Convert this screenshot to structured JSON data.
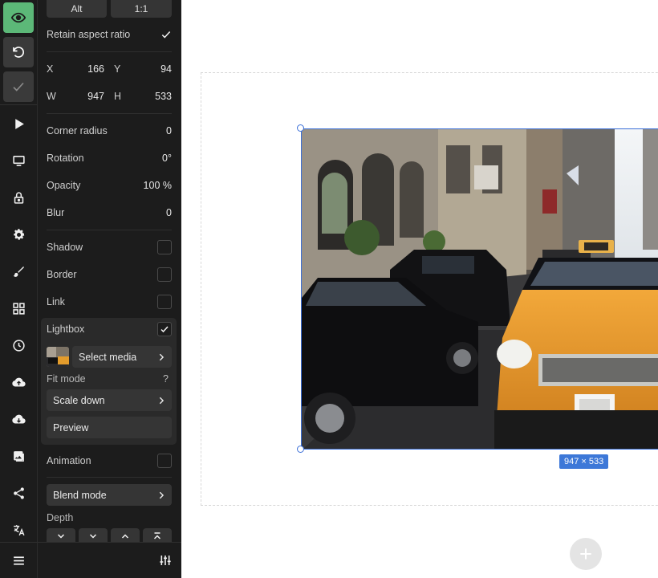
{
  "toolbar": {
    "rail_icons": [
      "eye-icon",
      "undo-icon",
      "check-icon",
      "play-icon",
      "monitor-icon",
      "lock-icon",
      "gear-icon",
      "brush-icon",
      "grid-icon",
      "clock-icon",
      "cloud-upload-icon",
      "cloud-download-icon",
      "image-icon",
      "share-icon",
      "translate-icon",
      "menu-icon"
    ]
  },
  "panel": {
    "alt_label": "Alt",
    "ratio_label": "1:1",
    "retain_aspect_label": "Retain aspect ratio",
    "retain_aspect_checked": true,
    "x_label": "X",
    "x_value": "166",
    "y_label": "Y",
    "y_value": "94",
    "w_label": "W",
    "w_value": "947",
    "h_label": "H",
    "h_value": "533",
    "corner_radius_label": "Corner radius",
    "corner_radius_value": "0",
    "rotation_label": "Rotation",
    "rotation_value": "0°",
    "opacity_label": "Opacity",
    "opacity_value": "100 %",
    "blur_label": "Blur",
    "blur_value": "0",
    "shadow_label": "Shadow",
    "shadow_checked": false,
    "border_label": "Border",
    "border_checked": false,
    "link_label": "Link",
    "link_checked": false,
    "lightbox_label": "Lightbox",
    "lightbox_checked": true,
    "select_media_label": "Select media",
    "fit_mode_label": "Fit mode",
    "fit_mode_help": "?",
    "fit_mode_value": "Scale down",
    "preview_label": "Preview",
    "animation_label": "Animation",
    "animation_checked": false,
    "blend_mode_label": "Blend mode",
    "depth_label": "Depth"
  },
  "canvas": {
    "dimension_badge": "947 × 533"
  },
  "colors": {
    "accent_green": "#5cb878",
    "selection_blue": "#3b6fd8",
    "panel_bg": "#1c1c1c"
  }
}
